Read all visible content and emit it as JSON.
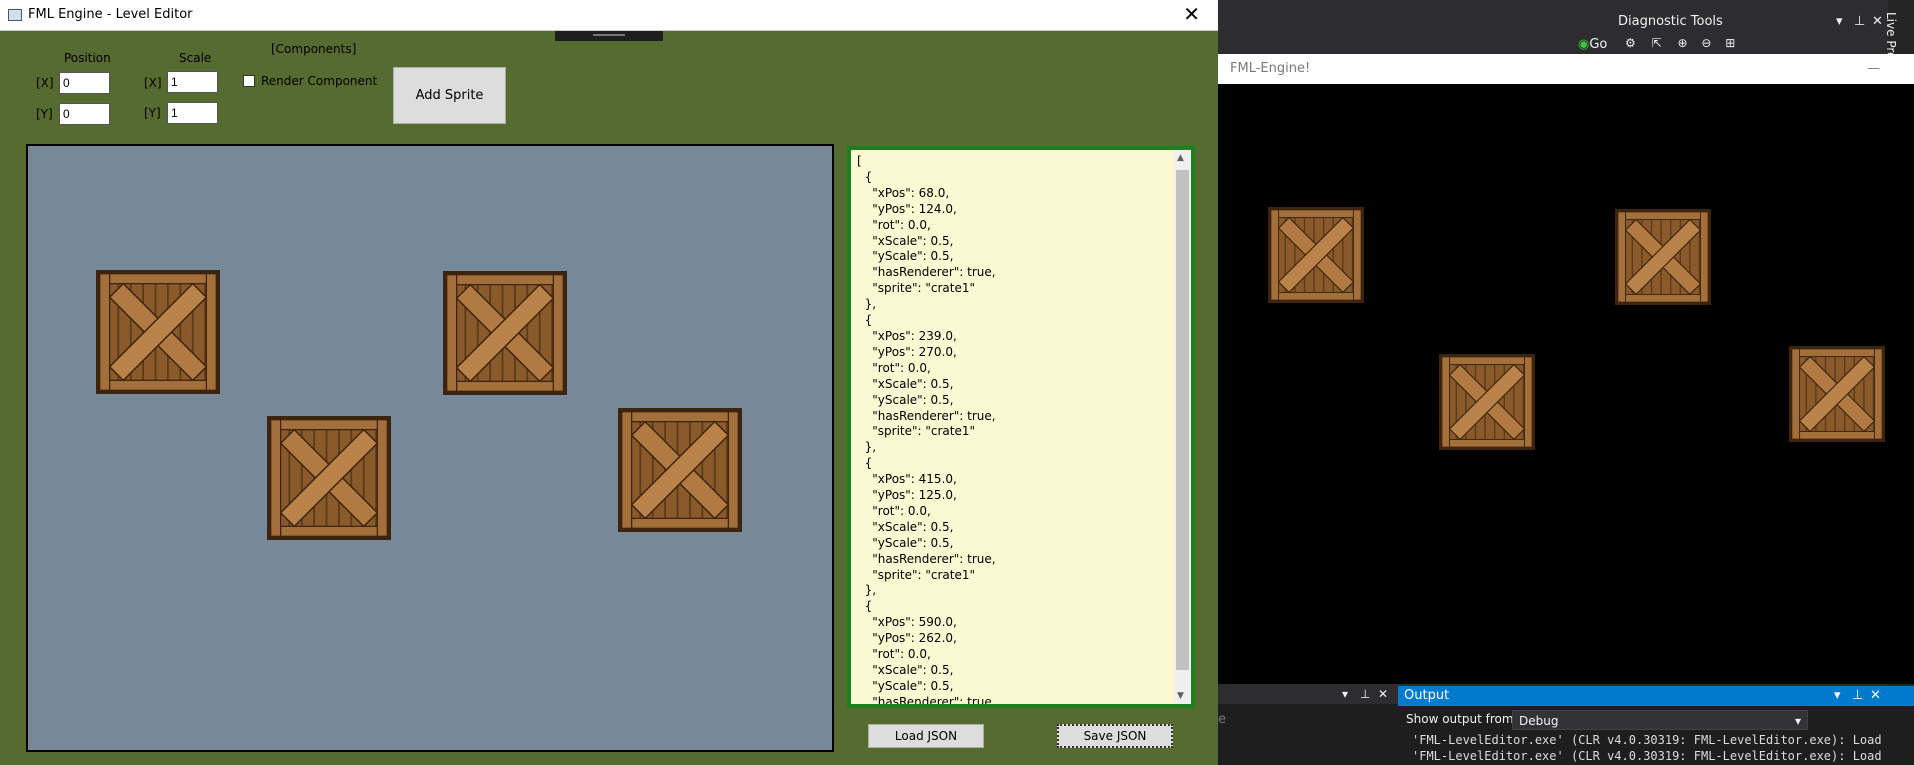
{
  "vs": {
    "diagnostic_tools": "Diagnostic Tools",
    "go_label": "Go",
    "live_label": "Live Prc",
    "output_title": "Output",
    "show_output_label": "Show output from:",
    "show_output_value": "Debug",
    "output_lines": [
      "'FML-LevelEditor.exe' (CLR v4.0.30319: FML-LevelEditor.exe): Load",
      "'FML-LevelEditor.exe' (CLR v4.0.30319: FML-LevelEditor.exe): Load"
    ],
    "left_pane_text": "e"
  },
  "engine": {
    "title": "FML-Engine!",
    "minimize": "—"
  },
  "editor": {
    "title": "FML Engine - Level Editor",
    "close": "✕",
    "position_label": "Position",
    "scale_label": "Scale",
    "components_label": "[Components]",
    "x_label": "[X]",
    "y_label": "[Y]",
    "position_x": "0",
    "position_y": "0",
    "scale_x": "1",
    "scale_y": "1",
    "render_component_label": "Render Component",
    "render_component_checked": false,
    "add_sprite_label": "Add Sprite",
    "load_json_label": "Load JSON",
    "save_json_label": "Save JSON",
    "json_text": "[\n  {\n    \"xPos\": 68.0,\n    \"yPos\": 124.0,\n    \"rot\": 0.0,\n    \"xScale\": 0.5,\n    \"yScale\": 0.5,\n    \"hasRenderer\": true,\n    \"sprite\": \"crate1\"\n  },\n  {\n    \"xPos\": 239.0,\n    \"yPos\": 270.0,\n    \"rot\": 0.0,\n    \"xScale\": 0.5,\n    \"yScale\": 0.5,\n    \"hasRenderer\": true,\n    \"sprite\": \"crate1\"\n  },\n  {\n    \"xPos\": 415.0,\n    \"yPos\": 125.0,\n    \"rot\": 0.0,\n    \"xScale\": 0.5,\n    \"yScale\": 0.5,\n    \"hasRenderer\": true,\n    \"sprite\": \"crate1\"\n  },\n  {\n    \"xPos\": 590.0,\n    \"yPos\": 262.0,\n    \"rot\": 0.0,\n    \"xScale\": 0.5,\n    \"yScale\": 0.5,\n    \"hasRenderer\": true,"
  },
  "colors": {
    "editor_bg": "#556b2f",
    "canvas_bg": "#778899",
    "json_border": "#1e7f1e",
    "json_bg": "#fafad2",
    "vs_accent": "#007acc"
  }
}
